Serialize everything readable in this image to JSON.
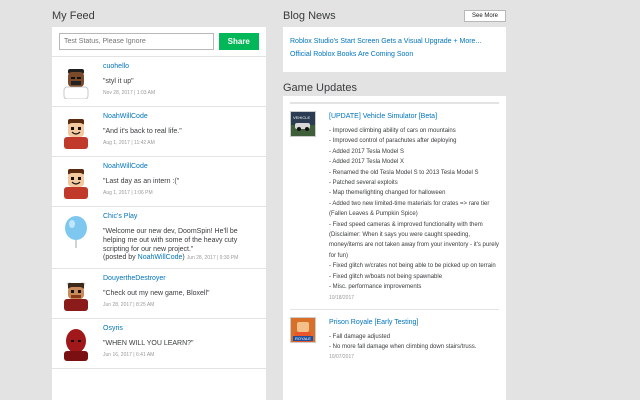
{
  "feed": {
    "title": "My Feed",
    "status_placeholder": "Test Status, Please Ignore",
    "share_label": "Share",
    "items": [
      {
        "name": "cuohello",
        "text": "\"styl it up\"",
        "date": "Nov 28, 2017 | 1:03 AM"
      },
      {
        "name": "NoahWillCode",
        "text": "\"And it's back to real life.\"",
        "date": "Aug 1, 2017 | 11:42 AM"
      },
      {
        "name": "NoahWillCode",
        "text": "\"Last day as an intern :(\"",
        "date": "Aug 1, 2017 | 1:06 PM"
      },
      {
        "name": "Chic's Play",
        "text": "\"Welcome our new dev, DoomSpin! He'll be helping me out with some of the heavy cuty scripting for our new project.\"",
        "posted_prefix": "(posted by ",
        "posted_by": "NoahWillCode",
        "posted_suffix": ")",
        "date": "Jun 28, 2017 | 9:30 PM"
      },
      {
        "name": "DouyertheDestroyer",
        "text": "\"Check out my new game, Bloxell\"",
        "date": "Jun 28, 2017 | 8:25 AM"
      },
      {
        "name": "Osyris",
        "text": "\"WHEN WILL YOU LEARN?\"",
        "date": "Jun 16, 2017 | 6:41 AM"
      }
    ]
  },
  "blog": {
    "title": "Blog News",
    "see_more": "See More",
    "links": [
      "Roblox Studio's Start Screen Gets a Visual Upgrade + More...",
      "Official Roblox Books Are Coming Soon"
    ]
  },
  "games": {
    "title": "Game Updates",
    "items": [
      {
        "title": "[UPDATE] Vehicle Simulator [Beta]",
        "lines": [
          "- Improved climbing ability of cars on mountains",
          "- Improved control of parachutes after deploying",
          "- Added 2017 Tesla Model S",
          "- Added 2017 Tesla Model X",
          "- Renamed the old Tesla Model S to 2013 Tesla Model S",
          "- Patched several exploits",
          "- Map theme/lighting changed for halloween",
          "- Added two new limited-time materials for crates => rare tier (Fallen Leaves & Pumpkin Spice)",
          "- Fixed speed cameras & improved functionality with them (Disclaimer: When it says you were caught speeding, money/items are not taken away from your inventory - it's purely for fun)",
          "- Fixed glitch w/crates not being able to be picked up on terrain",
          "- Fixed glitch w/boats not being spawnable",
          "- Misc. performance improvements"
        ],
        "date": "10/18/2017",
        "thumb_label": "VEHICLE"
      },
      {
        "title": "Prison Royale [Early Testing]",
        "lines": [
          "- Fall damage adjusted",
          "- No more fall damage when climbing down stairs/truss."
        ],
        "date": "10/07/2017",
        "thumb_label": "ROYALE"
      }
    ]
  },
  "colors": {
    "background": "#e3e3e3",
    "panel": "#ffffff",
    "link": "#0074bd",
    "share": "#02b757"
  }
}
